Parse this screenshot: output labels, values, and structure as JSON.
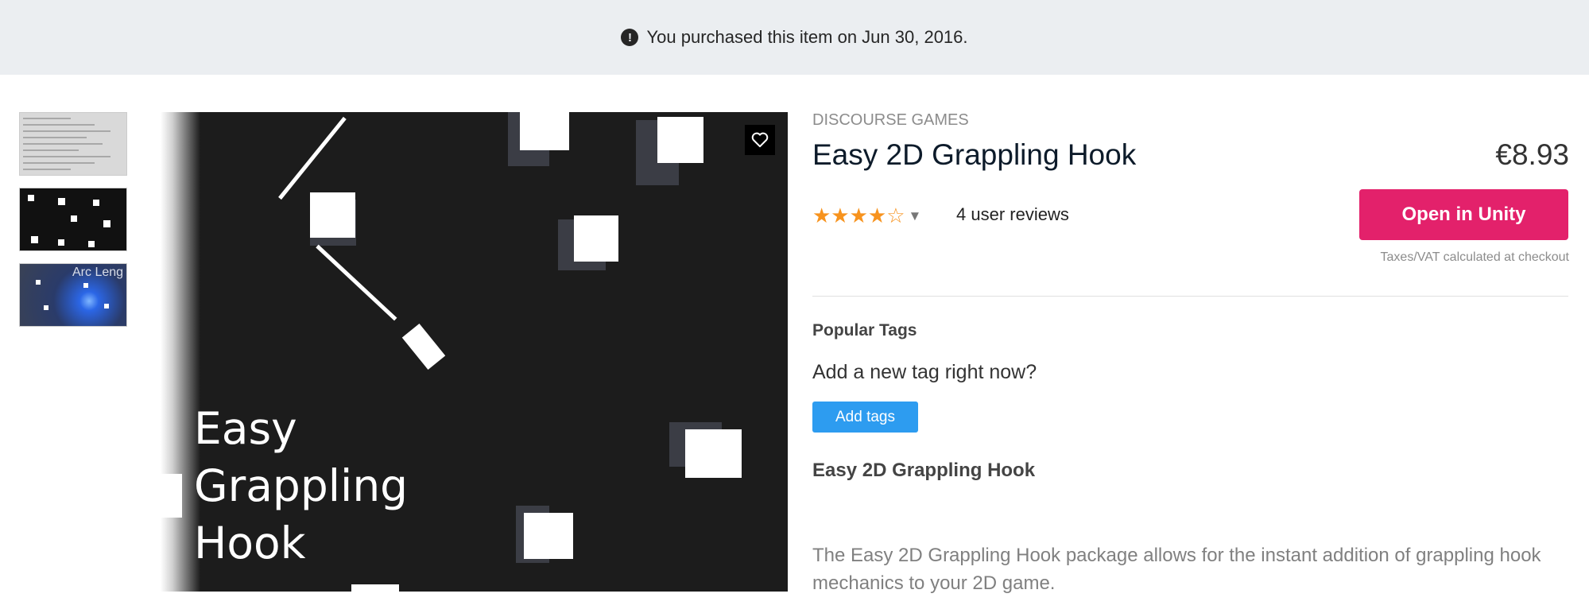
{
  "banner": {
    "icon": "alert-circle-icon",
    "text": "You purchased this item on Jun 30, 2016."
  },
  "gallery": {
    "thumbnail_icons": [
      "settings-screenshot",
      "gameplay-screenshot",
      "arc-length-screenshot"
    ],
    "thumbnail3_text": "Arc Leng",
    "hero_title_lines": [
      "Easy",
      "Grappling",
      "Hook"
    ],
    "favorite_icon": "heart-icon"
  },
  "product": {
    "publisher": "DISCOURSE GAMES",
    "title": "Easy 2D Grappling Hook",
    "price": "€8.93",
    "rating": {
      "value": 4,
      "max": 5,
      "stars": "★★★★☆",
      "dropdown": "▼"
    },
    "reviews": "4 user reviews",
    "open_button": "Open in Unity",
    "tax_note": "Taxes/VAT calculated at checkout"
  },
  "tags": {
    "heading": "Popular Tags",
    "prompt": "Add a new tag right now?",
    "add_button": "Add tags"
  },
  "description": {
    "heading": "Easy 2D Grappling Hook",
    "body": "The Easy 2D Grappling Hook package allows for the instant addition of grappling hook mechanics to your 2D game."
  },
  "colors": {
    "accent": "#e3216b",
    "tag_button": "#2d9cf0",
    "star": "#f7931e"
  }
}
